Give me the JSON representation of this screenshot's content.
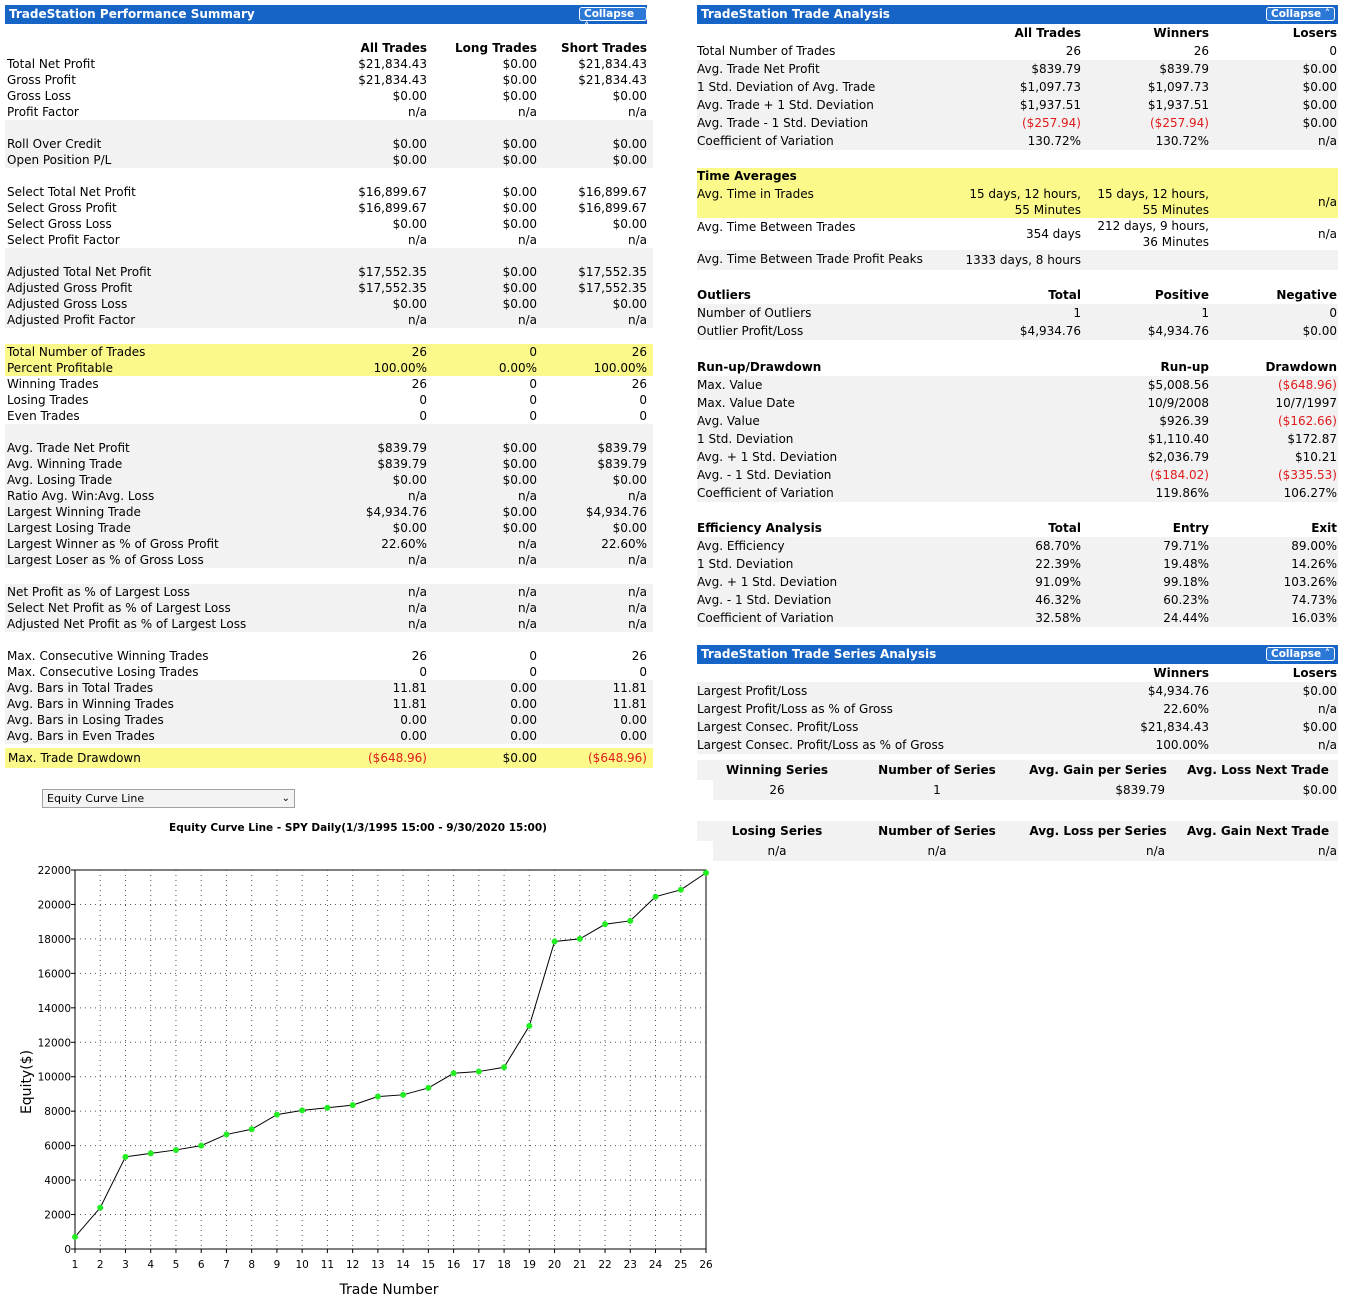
{
  "perf": {
    "title": "TradeStation Performance Summary",
    "collapse": "Collapse ˄",
    "columns": [
      "All Trades",
      "Long Trades",
      "Short Trades"
    ],
    "rows": [
      {
        "label": "Total Net Profit",
        "v": [
          "$21,834.43",
          "$0.00",
          "$21,834.43"
        ],
        "bg": "w"
      },
      {
        "label": "Gross Profit",
        "v": [
          "$21,834.43",
          "$0.00",
          "$21,834.43"
        ],
        "bg": "w"
      },
      {
        "label": "Gross Loss",
        "v": [
          "$0.00",
          "$0.00",
          "$0.00"
        ],
        "bg": "w"
      },
      {
        "label": "Profit Factor",
        "v": [
          "n/a",
          "n/a",
          "n/a"
        ],
        "bg": "w"
      },
      {
        "label": "",
        "v": [
          "",
          "",
          ""
        ],
        "bg": "g"
      },
      {
        "label": "Roll Over Credit",
        "v": [
          "$0.00",
          "$0.00",
          "$0.00"
        ],
        "bg": "g"
      },
      {
        "label": "Open Position P/L",
        "v": [
          "$0.00",
          "$0.00",
          "$0.00"
        ],
        "bg": "g"
      },
      {
        "label": "",
        "v": [
          "",
          "",
          ""
        ],
        "bg": "w"
      },
      {
        "label": "Select Total Net Profit",
        "v": [
          "$16,899.67",
          "$0.00",
          "$16,899.67"
        ],
        "bg": "w"
      },
      {
        "label": "Select Gross Profit",
        "v": [
          "$16,899.67",
          "$0.00",
          "$16,899.67"
        ],
        "bg": "w"
      },
      {
        "label": "Select Gross Loss",
        "v": [
          "$0.00",
          "$0.00",
          "$0.00"
        ],
        "bg": "w"
      },
      {
        "label": "Select Profit Factor",
        "v": [
          "n/a",
          "n/a",
          "n/a"
        ],
        "bg": "w"
      },
      {
        "label": "",
        "v": [
          "",
          "",
          ""
        ],
        "bg": "g"
      },
      {
        "label": "Adjusted Total Net Profit",
        "v": [
          "$17,552.35",
          "$0.00",
          "$17,552.35"
        ],
        "bg": "g"
      },
      {
        "label": "Adjusted Gross Profit",
        "v": [
          "$17,552.35",
          "$0.00",
          "$17,552.35"
        ],
        "bg": "g"
      },
      {
        "label": "Adjusted Gross Loss",
        "v": [
          "$0.00",
          "$0.00",
          "$0.00"
        ],
        "bg": "g"
      },
      {
        "label": "Adjusted Profit Factor",
        "v": [
          "n/a",
          "n/a",
          "n/a"
        ],
        "bg": "g"
      },
      {
        "label": "",
        "v": [
          "",
          "",
          ""
        ],
        "bg": "w"
      },
      {
        "label": "Total Number of Trades",
        "v": [
          "26",
          "0",
          "26"
        ],
        "bg": "y"
      },
      {
        "label": "Percent Profitable",
        "v": [
          "100.00%",
          "0.00%",
          "100.00%"
        ],
        "bg": "y"
      },
      {
        "label": "Winning Trades",
        "v": [
          "26",
          "0",
          "26"
        ],
        "bg": "w"
      },
      {
        "label": "Losing Trades",
        "v": [
          "0",
          "0",
          "0"
        ],
        "bg": "w"
      },
      {
        "label": "Even Trades",
        "v": [
          "0",
          "0",
          "0"
        ],
        "bg": "w"
      },
      {
        "label": "",
        "v": [
          "",
          "",
          ""
        ],
        "bg": "g"
      },
      {
        "label": "Avg. Trade Net Profit",
        "v": [
          "$839.79",
          "$0.00",
          "$839.79"
        ],
        "bg": "g"
      },
      {
        "label": "Avg. Winning Trade",
        "v": [
          "$839.79",
          "$0.00",
          "$839.79"
        ],
        "bg": "g"
      },
      {
        "label": "Avg. Losing Trade",
        "v": [
          "$0.00",
          "$0.00",
          "$0.00"
        ],
        "bg": "g"
      },
      {
        "label": "Ratio Avg. Win:Avg. Loss",
        "v": [
          "n/a",
          "n/a",
          "n/a"
        ],
        "bg": "g"
      },
      {
        "label": "Largest Winning Trade",
        "v": [
          "$4,934.76",
          "$0.00",
          "$4,934.76"
        ],
        "bg": "g"
      },
      {
        "label": "Largest Losing Trade",
        "v": [
          "$0.00",
          "$0.00",
          "$0.00"
        ],
        "bg": "g"
      },
      {
        "label": "Largest Winner as % of Gross Profit",
        "v": [
          "22.60%",
          "n/a",
          "22.60%"
        ],
        "bg": "g"
      },
      {
        "label": "Largest Loser as % of Gross Loss",
        "v": [
          "n/a",
          "n/a",
          "n/a"
        ],
        "bg": "g"
      },
      {
        "label": "",
        "v": [
          "",
          "",
          ""
        ],
        "bg": "w"
      },
      {
        "label": "Net Profit as % of Largest Loss",
        "v": [
          "n/a",
          "n/a",
          "n/a"
        ],
        "bg": "g"
      },
      {
        "label": "Select Net Profit as % of Largest Loss",
        "v": [
          "n/a",
          "n/a",
          "n/a"
        ],
        "bg": "g"
      },
      {
        "label": "Adjusted Net Profit as % of Largest Loss",
        "v": [
          "n/a",
          "n/a",
          "n/a"
        ],
        "bg": "g"
      },
      {
        "label": "",
        "v": [
          "",
          "",
          ""
        ],
        "bg": "w"
      },
      {
        "label": "Max. Consecutive Winning Trades",
        "v": [
          "26",
          "0",
          "26"
        ],
        "bg": "w"
      },
      {
        "label": "Max. Consecutive Losing Trades",
        "v": [
          "0",
          "0",
          "0"
        ],
        "bg": "w"
      },
      {
        "label": "Avg. Bars in Total Trades",
        "v": [
          "11.81",
          "0.00",
          "11.81"
        ],
        "bg": "g"
      },
      {
        "label": "Avg. Bars in Winning Trades",
        "v": [
          "11.81",
          "0.00",
          "11.81"
        ],
        "bg": "g"
      },
      {
        "label": "Avg. Bars in Losing Trades",
        "v": [
          "0.00",
          "0.00",
          "0.00"
        ],
        "bg": "g"
      },
      {
        "label": "Avg. Bars in Even Trades",
        "v": [
          "0.00",
          "0.00",
          "0.00"
        ],
        "bg": "g"
      }
    ],
    "drawdown": {
      "label": "Max. Trade Drawdown",
      "v": [
        "($648.96)",
        "$0.00",
        "($648.96)"
      ]
    }
  },
  "trade": {
    "title": "TradeStation Trade Analysis",
    "collapse": "Collapse ˄",
    "columns": [
      "All Trades",
      "Winners",
      "Losers"
    ],
    "rows": [
      {
        "label": "Total Number of Trades",
        "v": [
          "26",
          "26",
          "0"
        ],
        "bg": "w"
      },
      {
        "label": "Avg. Trade Net Profit",
        "v": [
          "$839.79",
          "$839.79",
          "$0.00"
        ],
        "bg": "g"
      },
      {
        "label": "1 Std. Deviation of Avg. Trade",
        "v": [
          "$1,097.73",
          "$1,097.73",
          "$0.00"
        ],
        "bg": "g"
      },
      {
        "label": "Avg. Trade + 1 Std. Deviation",
        "v": [
          "$1,937.51",
          "$1,937.51",
          "$0.00"
        ],
        "bg": "g"
      },
      {
        "label": "Avg. Trade - 1 Std. Deviation",
        "v": [
          "($257.94)",
          "($257.94)",
          "$0.00"
        ],
        "bg": "g",
        "neg": [
          true,
          true,
          false
        ]
      },
      {
        "label": "Coefficient of Variation",
        "v": [
          "130.72%",
          "130.72%",
          "n/a"
        ],
        "bg": "g"
      }
    ],
    "time": {
      "header": "Time Averages",
      "avg_time_label": "Avg. Time in Trades",
      "avg_time_all_1": "15 days, 12 hours,",
      "avg_time_all_2": "55 Minutes",
      "avg_time_win_1": "15 days, 12 hours,",
      "avg_time_win_2": "55 Minutes",
      "avg_time_lose": "n/a",
      "between_label": "Avg. Time Between Trades",
      "between_all": "354 days",
      "between_win_1": "212 days, 9 hours,",
      "between_win_2": "36 Minutes",
      "between_lose": "n/a",
      "peaks_label": "Avg. Time Between Trade Profit Peaks",
      "peaks_all": "1333 days, 8 hours"
    },
    "outliers": {
      "header": "Outliers",
      "columns": [
        "Total",
        "Positive",
        "Negative"
      ],
      "rows": [
        {
          "label": "Number of Outliers",
          "v": [
            "1",
            "1",
            "0"
          ]
        },
        {
          "label": "Outlier Profit/Loss",
          "v": [
            "$4,934.76",
            "$4,934.76",
            "$0.00"
          ]
        }
      ]
    },
    "runup": {
      "header": "Run-up/Drawdown",
      "columns": [
        "Run-up",
        "Drawdown"
      ],
      "rows": [
        {
          "label": "Max. Value",
          "v": [
            "$5,008.56",
            "($648.96)"
          ],
          "neg": [
            false,
            true
          ]
        },
        {
          "label": "Max. Value Date",
          "v": [
            "10/9/2008",
            "10/7/1997"
          ],
          "neg": [
            false,
            false
          ]
        },
        {
          "label": "Avg. Value",
          "v": [
            "$926.39",
            "($162.66)"
          ],
          "neg": [
            false,
            true
          ]
        },
        {
          "label": "1 Std. Deviation",
          "v": [
            "$1,110.40",
            "$172.87"
          ],
          "neg": [
            false,
            false
          ]
        },
        {
          "label": "Avg. + 1 Std. Deviation",
          "v": [
            "$2,036.79",
            "$10.21"
          ],
          "neg": [
            false,
            false
          ]
        },
        {
          "label": "Avg. - 1 Std. Deviation",
          "v": [
            "($184.02)",
            "($335.53)"
          ],
          "neg": [
            true,
            true
          ]
        },
        {
          "label": "Coefficient of Variation",
          "v": [
            "119.86%",
            "106.27%"
          ],
          "neg": [
            false,
            false
          ]
        }
      ]
    },
    "efficiency": {
      "header": "Efficiency Analysis",
      "columns": [
        "Total",
        "Entry",
        "Exit"
      ],
      "rows": [
        {
          "label": "Avg. Efficiency",
          "v": [
            "68.70%",
            "79.71%",
            "89.00%"
          ]
        },
        {
          "label": "1 Std. Deviation",
          "v": [
            "22.39%",
            "19.48%",
            "14.26%"
          ]
        },
        {
          "label": "Avg. + 1 Std. Deviation",
          "v": [
            "91.09%",
            "99.18%",
            "103.26%"
          ]
        },
        {
          "label": "Avg. - 1 Std. Deviation",
          "v": [
            "46.32%",
            "60.23%",
            "74.73%"
          ]
        },
        {
          "label": "Coefficient of Variation",
          "v": [
            "32.58%",
            "24.44%",
            "16.03%"
          ]
        }
      ]
    }
  },
  "series": {
    "title": "TradeStation Trade Series Analysis",
    "collapse": "Collapse ˄",
    "columns": [
      "Winners",
      "Losers"
    ],
    "rows": [
      {
        "label": "Largest Profit/Loss",
        "v": [
          "$4,934.76",
          "$0.00"
        ]
      },
      {
        "label": "Largest Profit/Loss as % of Gross",
        "v": [
          "22.60%",
          "n/a"
        ]
      },
      {
        "label": "Largest Consec. Profit/Loss",
        "v": [
          "$21,834.43",
          "$0.00"
        ]
      },
      {
        "label": "Largest Consec. Profit/Loss as % of Gross",
        "v": [
          "100.00%",
          "n/a"
        ]
      }
    ],
    "win_headers": [
      "Winning Series",
      "Number of Series",
      "Avg. Gain per Series",
      "Avg. Loss Next Trade"
    ],
    "win_values": [
      "26",
      "1",
      "$839.79",
      "$0.00"
    ],
    "lose_headers": [
      "Losing Series",
      "Number of Series",
      "Avg. Loss per Series",
      "Avg. Gain Next Trade"
    ],
    "lose_values": [
      "n/a",
      "n/a",
      "n/a",
      "n/a"
    ]
  },
  "chart_select": "Equity Curve Line",
  "chart_data": {
    "type": "line",
    "title": "Equity Curve Line - SPY Daily(1/3/1995 15:00 - 9/30/2020 15:00)",
    "xlabel": "Trade Number",
    "ylabel": "Equity($)",
    "x": [
      1,
      2,
      3,
      4,
      5,
      6,
      7,
      8,
      9,
      10,
      11,
      12,
      13,
      14,
      15,
      16,
      17,
      18,
      19,
      20,
      21,
      22,
      23,
      24,
      25,
      26
    ],
    "series": [
      {
        "values": [
          700,
          2400,
          5350,
          5550,
          5750,
          6000,
          6650,
          6950,
          7800,
          8050,
          8200,
          8350,
          8850,
          8950,
          9350,
          10200,
          10300,
          10550,
          12950,
          17850,
          18000,
          18850,
          19050,
          20450,
          20850,
          21834
        ]
      }
    ],
    "ylim": [
      0,
      22000
    ],
    "yticks": [
      0,
      2000,
      4000,
      6000,
      8000,
      10000,
      12000,
      14000,
      16000,
      18000,
      20000,
      22000
    ],
    "grid": true,
    "line_color": "#000000",
    "marker_color": "#22ee22"
  }
}
